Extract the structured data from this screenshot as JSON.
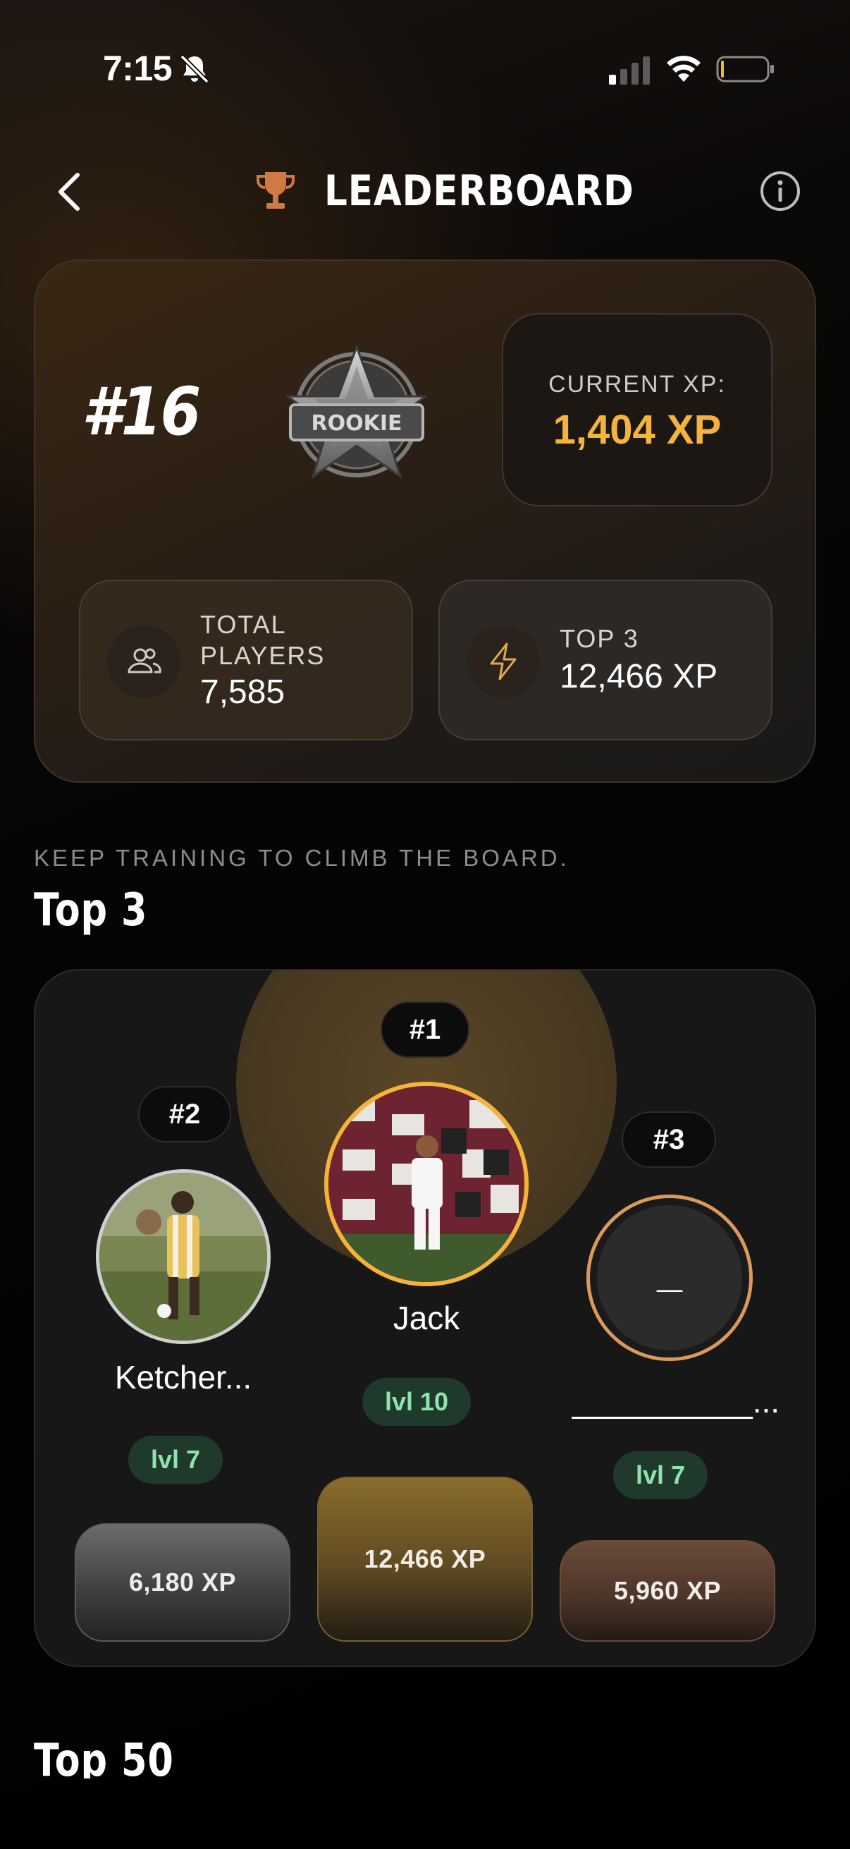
{
  "status_bar": {
    "time": "7:15"
  },
  "header": {
    "title": "LEADERBOARD"
  },
  "rank_card": {
    "rank": "#16",
    "badge_text": "ROOKIE",
    "current_xp_label": "CURRENT XP:",
    "current_xp_value": "1,404 XP",
    "total_players_label": "TOTAL PLAYERS",
    "total_players_value": "7,585",
    "top3_label": "TOP 3",
    "top3_value": "12,466 XP"
  },
  "section": {
    "subtitle": "KEEP TRAINING TO CLIMB THE BOARD.",
    "top3_title": "Top 3",
    "top50_title": "Top 50"
  },
  "podium": [
    {
      "rank": "#2",
      "name": "Ketcher...",
      "level": "lvl 7",
      "xp": "6,180 XP"
    },
    {
      "rank": "#1",
      "name": "Jack",
      "level": "lvl 10",
      "xp": "12,466 XP"
    },
    {
      "rank": "#3",
      "name": "__________...",
      "level": "lvl 7",
      "xp": "5,960 XP",
      "avatar_placeholder": "_"
    }
  ],
  "colors": {
    "accent_gold": "#f4b43a",
    "level_green": "#8fe3ab",
    "bronze": "#d99a5a",
    "silver": "#cfcfcf"
  }
}
